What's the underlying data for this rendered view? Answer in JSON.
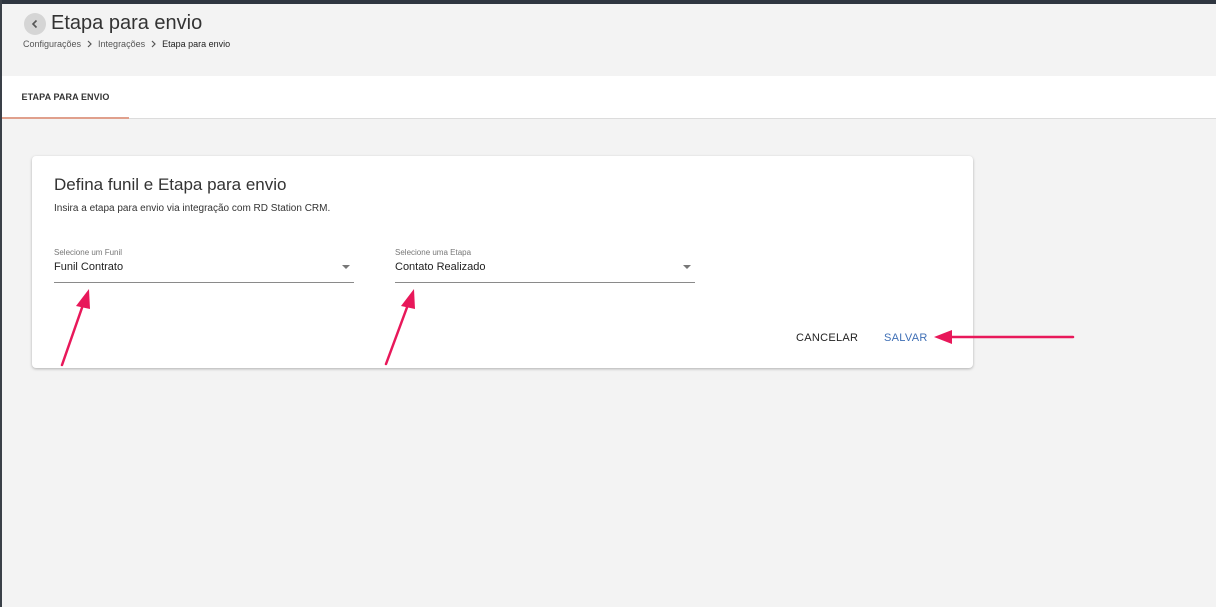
{
  "header": {
    "title": "Etapa para envio",
    "breadcrumb": [
      "Configurações",
      "Integrações",
      "Etapa para envio"
    ]
  },
  "tabs": [
    {
      "label": "ETAPA PARA ENVIO",
      "active": true
    }
  ],
  "card": {
    "title": "Defina funil e Etapa para envio",
    "subtitle": "Insira a etapa para envio via integração com RD Station CRM.",
    "funnel_select": {
      "label": "Selecione um Funil",
      "value": "Funil Contrato"
    },
    "stage_select": {
      "label": "Selecione uma Etapa",
      "value": "Contato Realizado"
    },
    "actions": {
      "cancel_label": "CANCELAR",
      "save_label": "SALVAR"
    }
  },
  "icons": {
    "back": "chevron-left-icon",
    "breadcrumb_separator": "chevron-right-icon",
    "dropdown": "caret-down-icon"
  },
  "colors": {
    "save_accent": "#3f6fb5",
    "tab_indicator": "#e0a08c",
    "annotation_arrow": "#e8185a"
  }
}
